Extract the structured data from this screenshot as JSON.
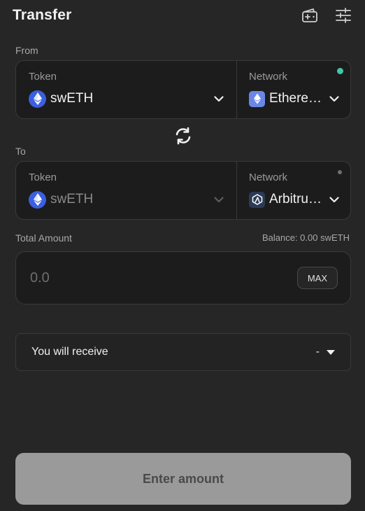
{
  "header": {
    "title": "Transfer"
  },
  "from": {
    "section_label": "From",
    "token_label": "Token",
    "token": "swETH",
    "network_label": "Network",
    "network": "Ethere …",
    "status_color": "#3ec9a7"
  },
  "swap_icon": "swap-arrows-icon",
  "to": {
    "section_label": "To",
    "token_label": "Token",
    "token": "swETH",
    "network_label": "Network",
    "network": "Arbitru…",
    "status_color": "#6e6e6e"
  },
  "amount": {
    "label": "Total Amount",
    "balance": "Balance: 0.00 swETH",
    "placeholder": "0.0",
    "max_label": "MAX"
  },
  "receive": {
    "label": "You will receive",
    "value": "-"
  },
  "cta": {
    "label": "Enter amount"
  },
  "colors": {
    "background": "#262626",
    "card": "#1c1c1c",
    "eth_blue": "#3a5fe0",
    "cta_disabled": "#9a9a9a"
  }
}
